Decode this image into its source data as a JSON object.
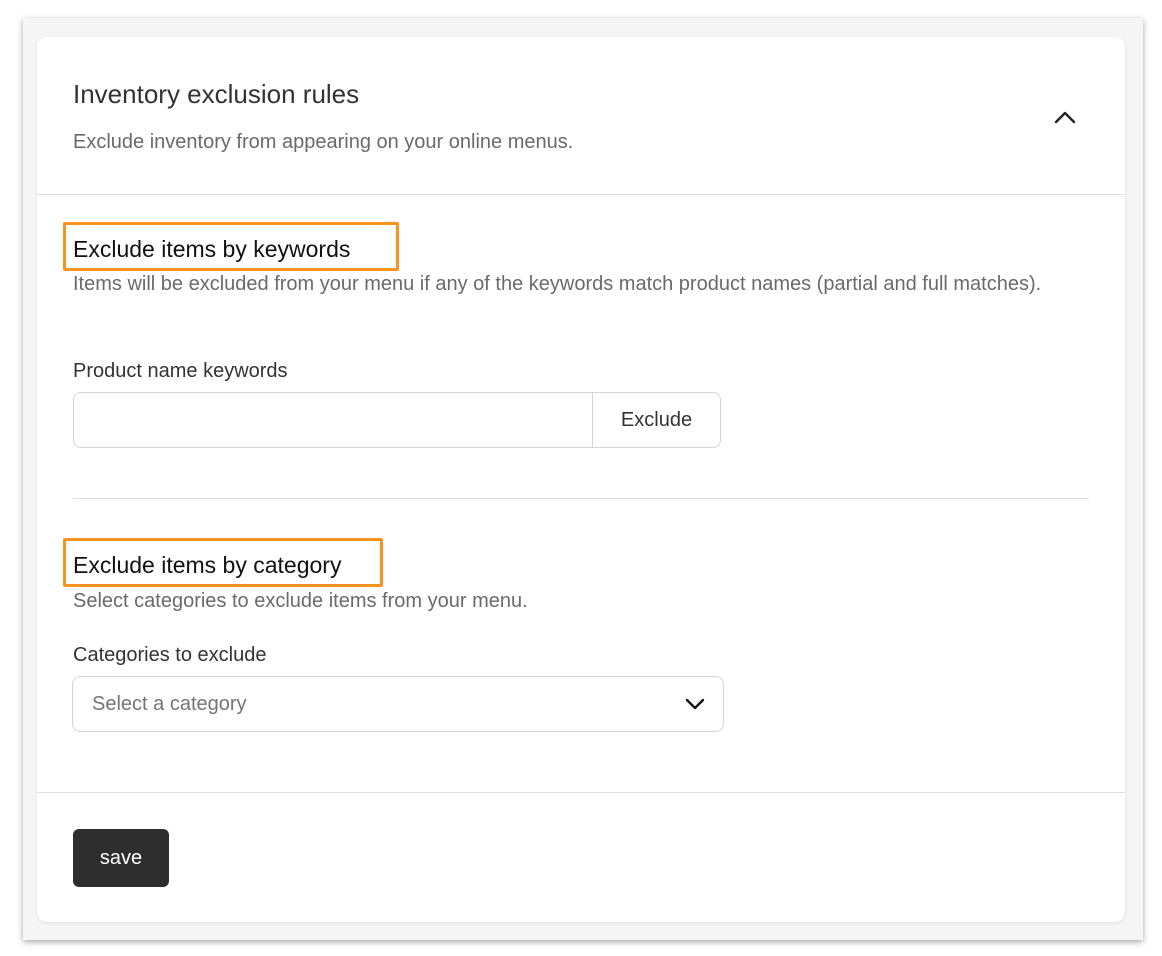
{
  "card": {
    "title": "Inventory exclusion rules",
    "subtitle": "Exclude inventory from appearing on your online menus.",
    "collapse_icon": "chevron-up-icon"
  },
  "keywords_section": {
    "title": "Exclude items by keywords",
    "description": "Items will be excluded from your menu if any of the keywords match product names (partial and full matches).",
    "field_label": "Product name keywords",
    "input_value": "",
    "input_placeholder": "",
    "exclude_label": "Exclude"
  },
  "category_section": {
    "title": "Exclude items by category",
    "description": "Select categories to exclude items from your menu.",
    "field_label": "Categories to exclude",
    "select_placeholder": "Select a category",
    "select_icon": "chevron-down-icon"
  },
  "footer": {
    "save_label": "save"
  },
  "colors": {
    "highlight": "#f7931e",
    "save_button_bg": "#2e2e2e",
    "title_text": "#333333",
    "muted_text": "#6a6a6a"
  }
}
